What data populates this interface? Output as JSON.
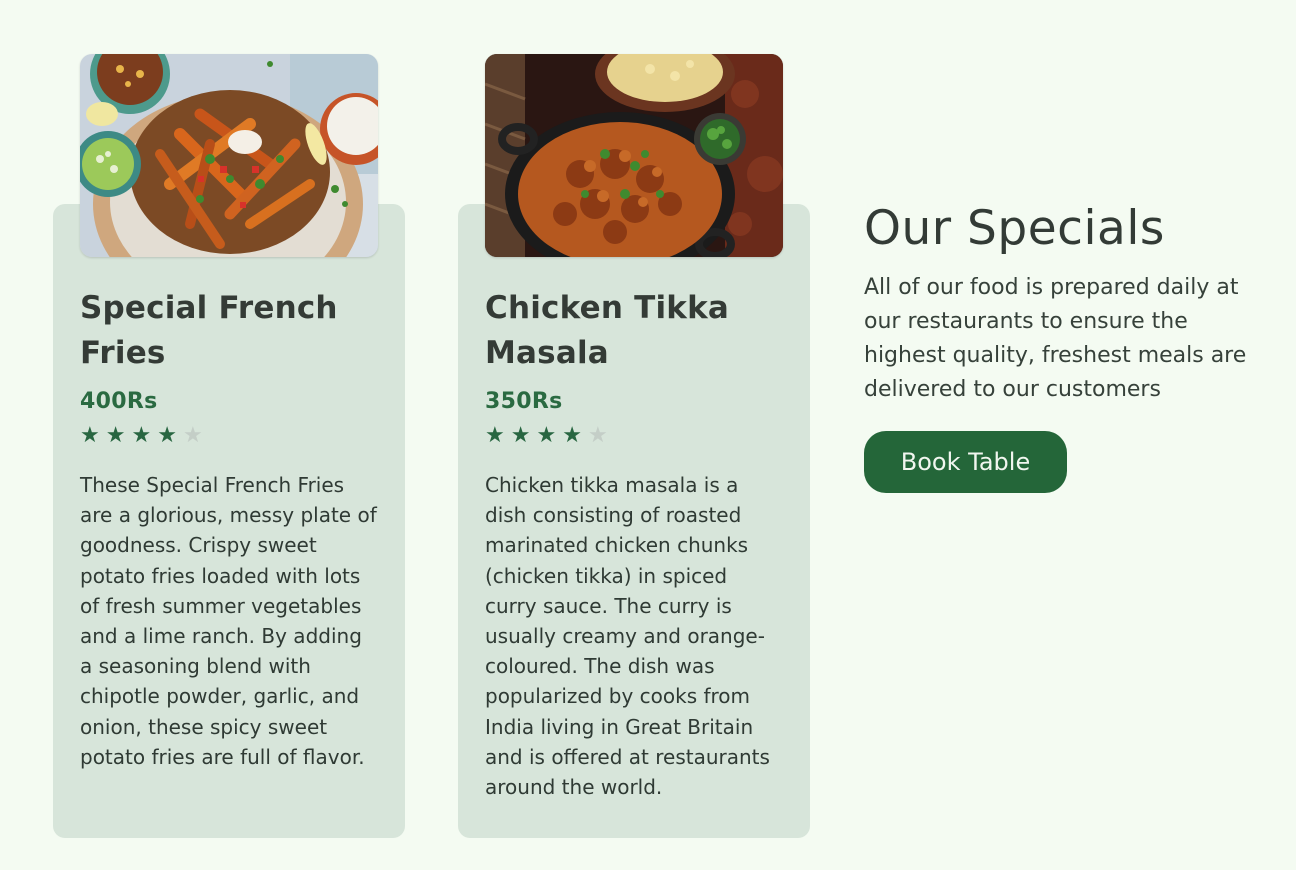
{
  "colors": {
    "page_background": "#f4fbf2",
    "card_background": "#d7e5da",
    "accent_green": "#246639",
    "price_green": "#2a6a41",
    "star_off": "#c4cec7"
  },
  "dishes": [
    {
      "title": "Special French Fries",
      "price": "400Rs",
      "rating": 4,
      "rating_max": 5,
      "description": "These Special French Fries are a glorious, messy plate of goodness. Crispy sweet potato fries loaded with lots of fresh summer vegetables and a lime ranch. By adding a seasoning blend with chipotle powder, garlic, and onion, these spicy sweet potato fries are full of flavor."
    },
    {
      "title": "Chicken Tikka Masala",
      "price": "350Rs",
      "rating": 4,
      "rating_max": 5,
      "description": "Chicken tikka masala is a dish consisting of roasted marinated chicken chunks (chicken tikka) in spiced curry sauce. The curry is usually creamy and orange-coloured. The dish was popularized by cooks from India living in Great Britain and is offered at restaurants around the world."
    }
  ],
  "specials": {
    "title": "Our Specials",
    "text": "All of our food is prepared daily at our restaurants to ensure the highest quality, freshest meals are delivered to our customers",
    "button_label": "Book Table"
  }
}
